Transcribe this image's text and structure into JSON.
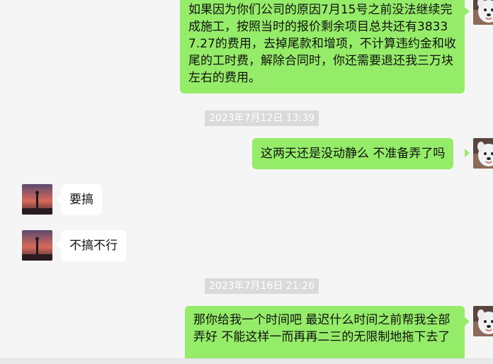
{
  "conversation": {
    "messages": [
      {
        "sender": "me",
        "text": "如果因为你们公司的原因7月15号之前没法继续完成施工，按照当时的报价剩余项目总共还有38337.27的费用，去掉尾款和增项，不计算违约金和收尾的工时费，解除合同时，你还需要退还我三万块左右的费用。"
      },
      {
        "timestamp": "2023年7月12日 13:39"
      },
      {
        "sender": "me",
        "text": "这两天还是没动静么 不准备弄了吗"
      },
      {
        "sender": "contact",
        "text": "要搞"
      },
      {
        "sender": "contact",
        "text": "不搞不行"
      },
      {
        "timestamp": "2023年7月16日 21:26"
      },
      {
        "sender": "me",
        "text": "那你给我一个时间吧 最迟什么时间之前帮我全部弄好  不能这样一而再再二三的无限制地拖下去了"
      }
    ]
  },
  "avatars": {
    "me": "samoyed-dog-avatar",
    "contact": "sunset-figure-avatar"
  },
  "colors": {
    "background": "#f5f5f5",
    "outgoing_bubble": "#95ec69",
    "incoming_bubble": "#ffffff",
    "timestamp_bg": "#dadada",
    "timestamp_text": "#ffffff"
  }
}
